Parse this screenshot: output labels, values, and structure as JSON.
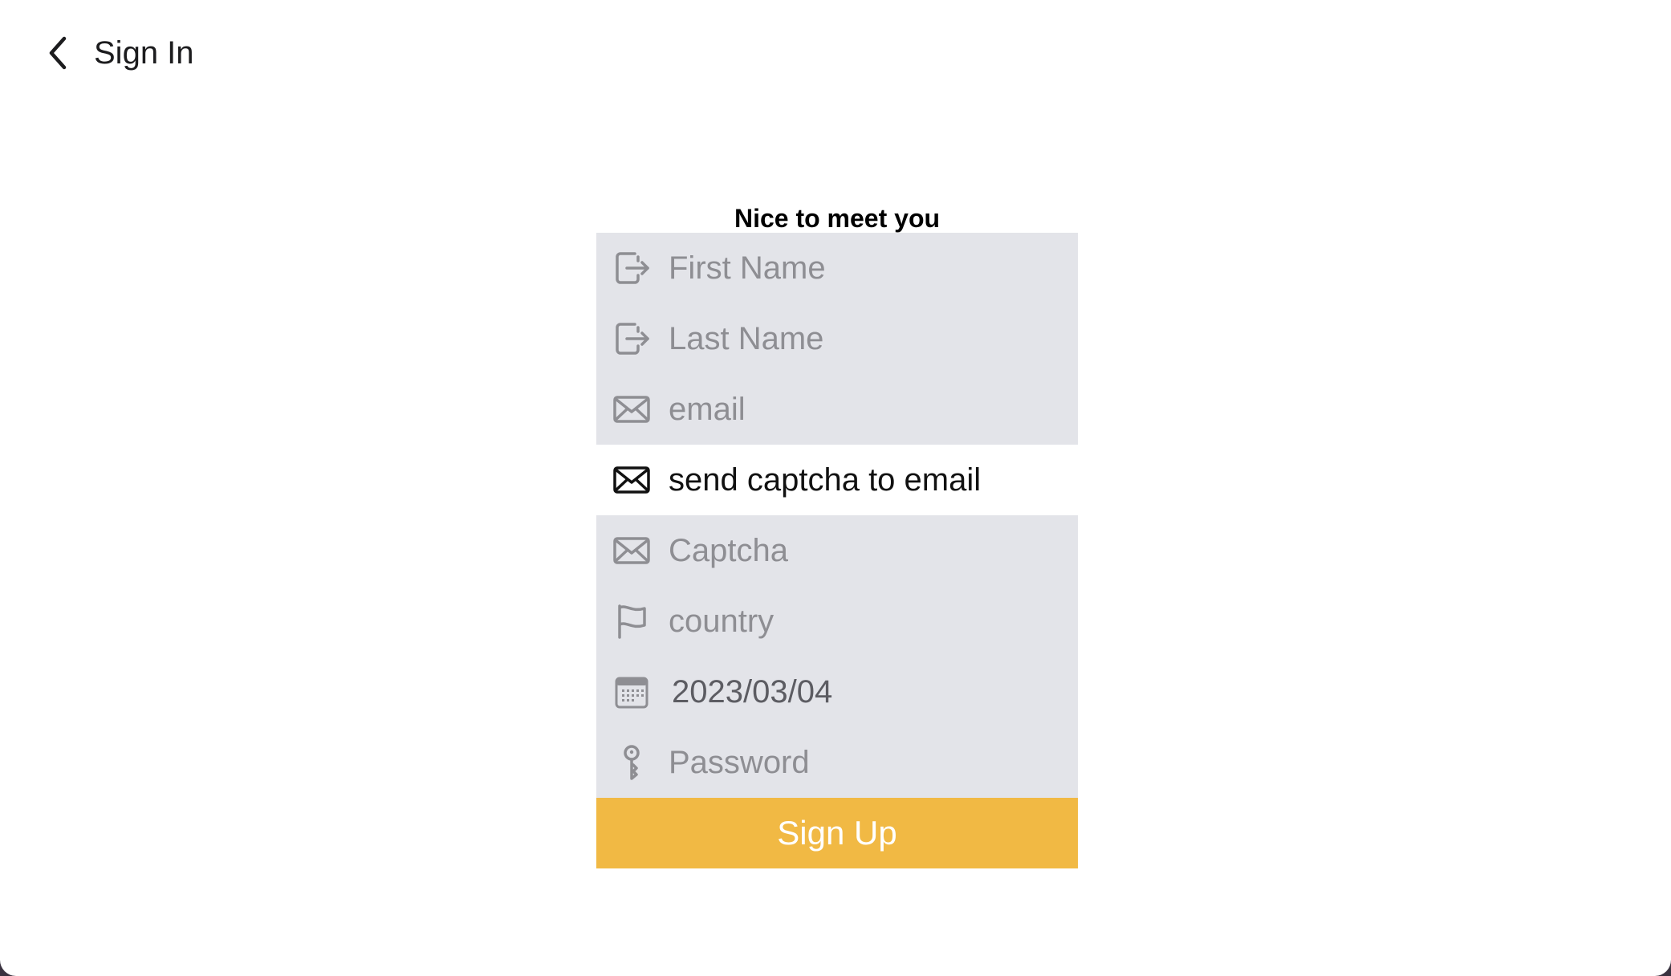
{
  "nav": {
    "back_icon": "chevron-left-icon",
    "back_label": "Sign In"
  },
  "form": {
    "title": "Nice to meet you",
    "fields": {
      "first_name": {
        "placeholder": "First Name",
        "icon": "sign-in-icon"
      },
      "last_name": {
        "placeholder": "Last Name",
        "icon": "sign-in-icon"
      },
      "email": {
        "placeholder": "email",
        "icon": "envelope-icon"
      },
      "captcha": {
        "placeholder": "Captcha",
        "icon": "envelope-icon"
      },
      "country": {
        "placeholder": "country",
        "icon": "flag-icon"
      },
      "birthdate": {
        "value": "2023/03/04",
        "icon": "calendar-icon"
      },
      "password": {
        "placeholder": "Password",
        "icon": "key-icon"
      }
    },
    "send_captcha": {
      "label": "send captcha to email",
      "icon": "envelope-icon"
    },
    "submit_label": "Sign Up"
  },
  "colors": {
    "field_background": "#e3e4e9",
    "accent": "#f1b944",
    "placeholder_text": "#8e8e93"
  }
}
